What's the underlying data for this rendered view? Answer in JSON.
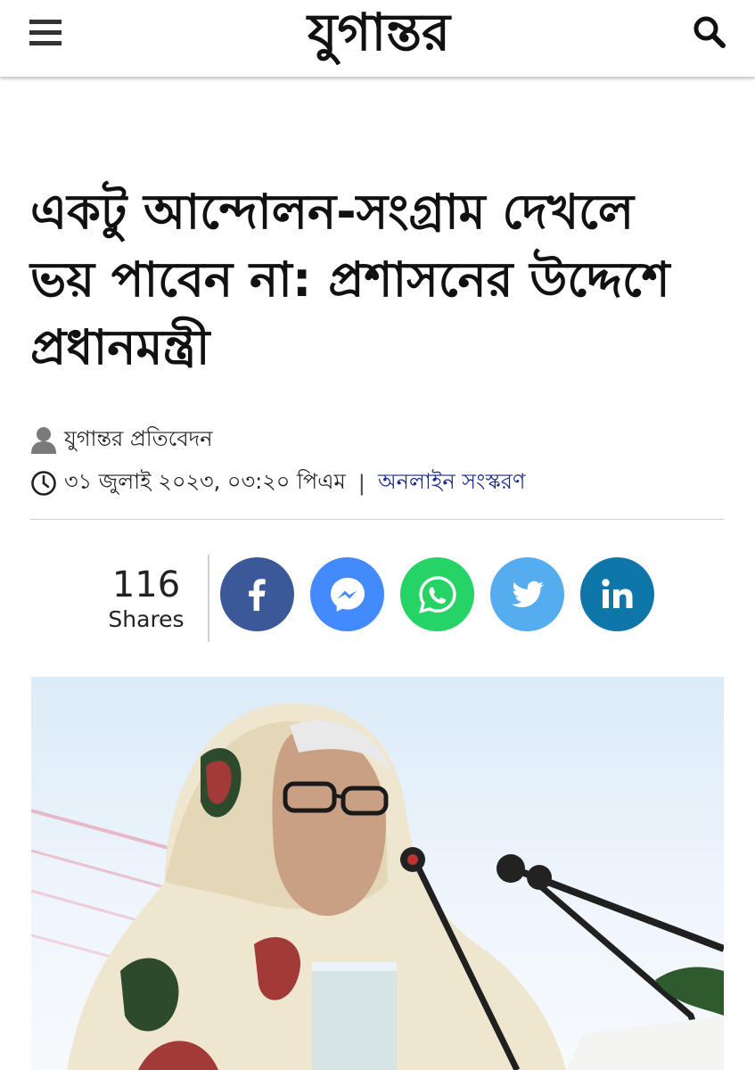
{
  "header": {
    "logo_text": "যুগান্তর",
    "menu_icon": "hamburger-menu-icon",
    "search_icon": "search-icon"
  },
  "article": {
    "headline_line1": "একটু আন্দোলন-সংগ্রাম দেখলে",
    "headline_line2": "ভয় পাবেন না: প্রশাসনের উদ্দেশে",
    "headline_line3": "প্রধানমন্ত্রী",
    "author": "যুগান্তর প্রতিবেদন",
    "datetime": "৩১ জুলাই ২০২৩, ০৩:২০ পিএম",
    "separator": "|",
    "edition": "অনলাইন সংস্করণ"
  },
  "share": {
    "count": "116",
    "label": "Shares",
    "buttons": [
      {
        "name": "facebook",
        "icon": "facebook-icon",
        "color": "#3b5998"
      },
      {
        "name": "messenger",
        "icon": "messenger-icon",
        "color": "#448aff"
      },
      {
        "name": "whatsapp",
        "icon": "whatsapp-icon",
        "color": "#25d366"
      },
      {
        "name": "twitter",
        "icon": "twitter-icon",
        "color": "#55acee"
      },
      {
        "name": "linkedin",
        "icon": "linkedin-icon",
        "color": "#0e76a8"
      }
    ]
  },
  "colors": {
    "edition_link": "#1b2a8e",
    "text": "#111111"
  }
}
